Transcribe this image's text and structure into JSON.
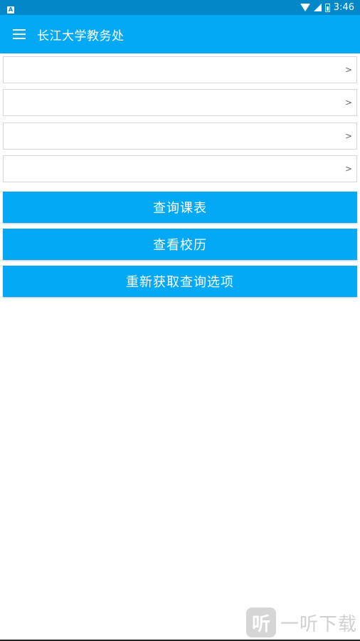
{
  "status_bar": {
    "app_badge": "A",
    "time": "3:46"
  },
  "app_bar": {
    "title": "长江大学教务处"
  },
  "selectors": [
    {
      "value": "",
      "chevron": ">"
    },
    {
      "value": "",
      "chevron": ">"
    },
    {
      "value": "",
      "chevron": ">"
    },
    {
      "value": "",
      "chevron": ">"
    }
  ],
  "buttons": {
    "query_schedule": "查询课表",
    "view_calendar": "查看校历",
    "refresh_options": "重新获取查询选项"
  },
  "watermark": {
    "logo_glyph": "听",
    "text": "一听下载"
  },
  "colors": {
    "status_bar": "#0288c9",
    "primary": "#03a9f4"
  }
}
